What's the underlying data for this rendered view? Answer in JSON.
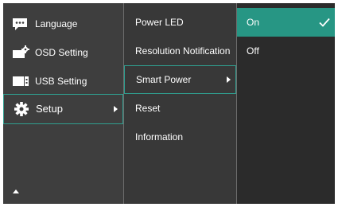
{
  "menu": {
    "main": [
      {
        "label": "Language",
        "icon": "language-icon"
      },
      {
        "label": "OSD Setting",
        "icon": "osd-setting-icon"
      },
      {
        "label": "USB Setting",
        "icon": "usb-setting-icon"
      },
      {
        "label": "Setup",
        "icon": "gear-icon"
      }
    ],
    "setup_items": [
      {
        "label": "Power LED"
      },
      {
        "label": "Resolution Notification"
      },
      {
        "label": "Smart Power"
      },
      {
        "label": "Reset"
      },
      {
        "label": "Information"
      }
    ],
    "options": [
      {
        "label": "On"
      },
      {
        "label": "Off"
      }
    ]
  },
  "colors": {
    "accent": "#279684",
    "highlight_border": "#2f9e8f"
  }
}
